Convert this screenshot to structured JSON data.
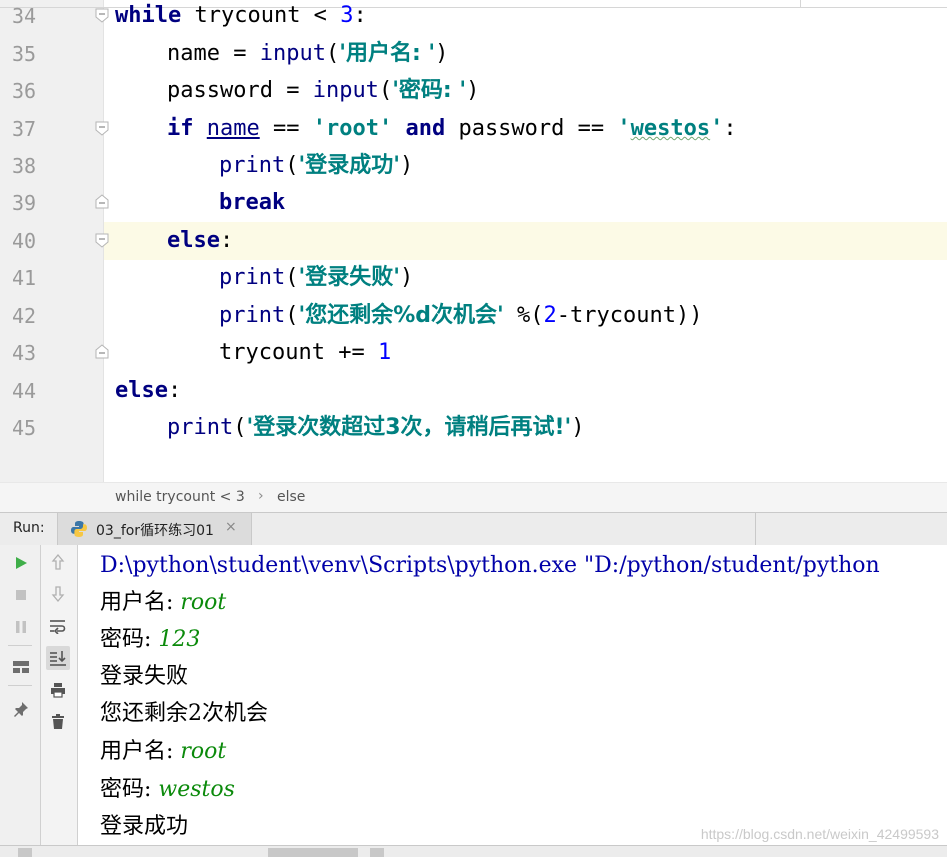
{
  "editor": {
    "lines": [
      {
        "num": "34"
      },
      {
        "num": "35"
      },
      {
        "num": "36"
      },
      {
        "num": "37"
      },
      {
        "num": "38"
      },
      {
        "num": "39"
      },
      {
        "num": "40"
      },
      {
        "num": "41"
      },
      {
        "num": "42"
      },
      {
        "num": "43"
      },
      {
        "num": "44"
      },
      {
        "num": "45"
      }
    ],
    "code": {
      "l34": {
        "kw": "while",
        "rest": " trycount < ",
        "num": "3",
        "end": ":"
      },
      "l35": {
        "a": "name = ",
        "fn": "input",
        "p1": "(",
        "str": "'用户名: '",
        "p2": ")"
      },
      "l36": {
        "a": "password = ",
        "fn": "input",
        "p1": "(",
        "str": "'密码: '",
        "p2": ")"
      },
      "l37": {
        "kw1": "if",
        "sp": " ",
        "var": "name",
        "eq": " == ",
        "str1": "'root'",
        "sp2": " ",
        "kw2": "and",
        "mid": " password == ",
        "q1": "'",
        "str2": "westos",
        "q2": "'",
        "end": ":"
      },
      "l38": {
        "fn": "print",
        "p1": "(",
        "str": "'登录成功'",
        "p2": ")"
      },
      "l39": {
        "kw": "break"
      },
      "l40": {
        "kw": "else",
        "end": ":"
      },
      "l41": {
        "fn": "print",
        "p1": "(",
        "str": "'登录失败'",
        "p2": ")"
      },
      "l42": {
        "fn": "print",
        "p1": "(",
        "str": "'您还剩余%d次机会'",
        "mid": " %(",
        "num": "2",
        "rest": "-trycount))"
      },
      "l43": {
        "a": "trycount += ",
        "num": "1"
      },
      "l44": {
        "kw": "else",
        "end": ":"
      },
      "l45": {
        "fn": "print",
        "p1": "(",
        "str": "'登录次数超过3次，请稍后再试!'",
        "p2": ")"
      }
    }
  },
  "breadcrumb": {
    "items": [
      "while trycount < 3",
      "else"
    ],
    "separator": "›"
  },
  "run": {
    "label": "Run:",
    "tab_label": "03_for循环练习01",
    "tab_close": "×"
  },
  "toolbar_icons": [
    "run-icon",
    "stop-icon",
    "pause-icon",
    "layout-icon",
    "pin-icon",
    "up-arrow-icon",
    "down-arrow-icon",
    "soft-wrap-icon",
    "scroll-to-end-icon",
    "print-icon",
    "trash-icon"
  ],
  "console": {
    "lines": [
      {
        "prompt": "D:\\python\\student\\venv\\Scripts\\python.exe \"D:/python/student/python"
      },
      {
        "prompt": "用户名: ",
        "input": "root"
      },
      {
        "prompt": "密码: ",
        "input": "123"
      },
      {
        "prompt": "登录失败"
      },
      {
        "prompt": "您还剩余2次机会"
      },
      {
        "prompt": "用户名: ",
        "input": "root"
      },
      {
        "prompt": "密码: ",
        "input": "westos"
      },
      {
        "prompt": "登录成功"
      }
    ]
  },
  "watermark": "https://blog.csdn.net/weixin_42499593",
  "colors": {
    "keyword": "#000080",
    "string": "#008080",
    "number": "#0000ff",
    "console_input": "#0b8a0b",
    "console_cmd": "#0000a8",
    "current_line": "#fcfae6"
  }
}
